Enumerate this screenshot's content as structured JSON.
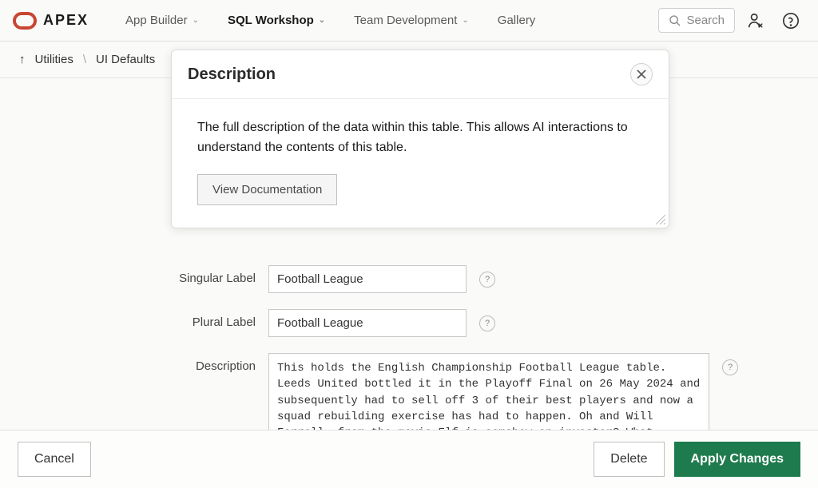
{
  "brand": {
    "name": "APEX"
  },
  "nav": {
    "items": [
      {
        "label": "App Builder",
        "hasDropdown": true
      },
      {
        "label": "SQL Workshop",
        "hasDropdown": true,
        "active": true
      },
      {
        "label": "Team Development",
        "hasDropdown": true
      },
      {
        "label": "Gallery",
        "hasDropdown": false
      }
    ],
    "search_placeholder": "Search"
  },
  "breadcrumb": {
    "items": [
      "Utilities",
      "UI Defaults"
    ]
  },
  "popover": {
    "title": "Description",
    "body": "The full description of the data within this table. This allows AI interactions to understand the contents of this table.",
    "doc_button": "View Documentation"
  },
  "form": {
    "singular": {
      "label": "Singular Label",
      "value": "Football League"
    },
    "plural": {
      "label": "Plural Label",
      "value": "Football League"
    },
    "description": {
      "label": "Description",
      "value": "This holds the English Championship Football League table. Leeds United bottled it in the Playoff Final on 26 May 2024 and subsequently had to sell off 3 of their best players and now a squad rebuilding exercise has had to happen. Oh and Will Ferrell, from the movie Elf is somehow an investor? What the...."
    }
  },
  "footer": {
    "cancel": "Cancel",
    "delete": "Delete",
    "apply": "Apply Changes"
  }
}
